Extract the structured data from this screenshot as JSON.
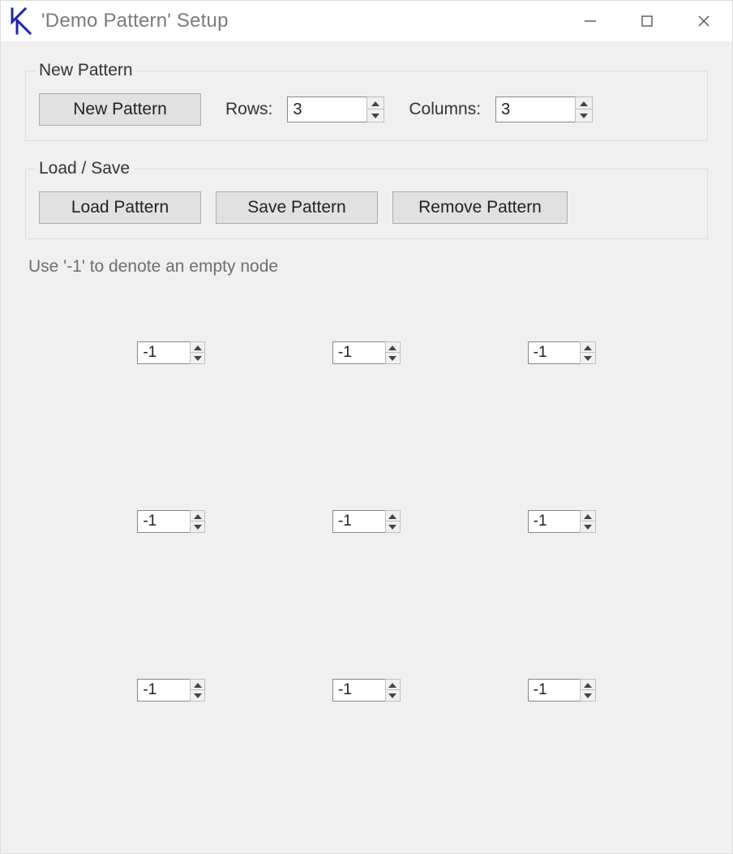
{
  "window": {
    "title": "'Demo Pattern' Setup"
  },
  "groups": {
    "new_pattern": {
      "legend": "New Pattern",
      "new_button": "New Pattern",
      "rows_label": "Rows:",
      "rows_value": "3",
      "cols_label": "Columns:",
      "cols_value": "3"
    },
    "load_save": {
      "legend": "Load / Save",
      "load_button": "Load Pattern",
      "save_button": "Save Pattern",
      "remove_button": "Remove Pattern"
    }
  },
  "hint": "Use '-1' to denote an empty node",
  "grid": [
    [
      "-1",
      "-1",
      "-1"
    ],
    [
      "-1",
      "-1",
      "-1"
    ],
    [
      "-1",
      "-1",
      "-1"
    ]
  ]
}
